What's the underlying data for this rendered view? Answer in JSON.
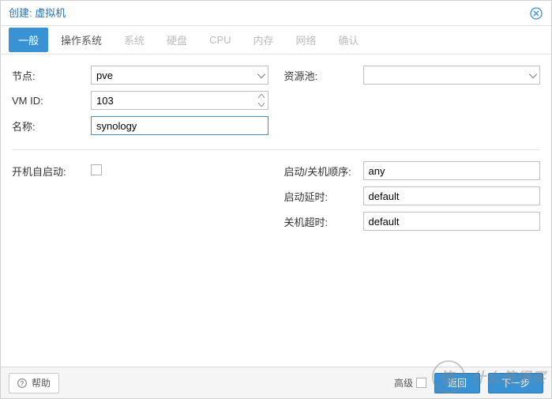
{
  "header": {
    "title": "创建: 虚拟机"
  },
  "tabs": [
    {
      "label": "一般",
      "active": true,
      "disabled": false
    },
    {
      "label": "操作系统",
      "active": false,
      "disabled": false
    },
    {
      "label": "系统",
      "active": false,
      "disabled": true
    },
    {
      "label": "硬盘",
      "active": false,
      "disabled": true
    },
    {
      "label": "CPU",
      "active": false,
      "disabled": true
    },
    {
      "label": "内存",
      "active": false,
      "disabled": true
    },
    {
      "label": "网络",
      "active": false,
      "disabled": true
    },
    {
      "label": "确认",
      "active": false,
      "disabled": true
    }
  ],
  "form": {
    "left": {
      "node_label": "节点:",
      "node_value": "pve",
      "vmid_label": "VM ID:",
      "vmid_value": "103",
      "name_label": "名称:",
      "name_value": "synology",
      "autostart_label": "开机自启动:",
      "autostart_checked": false
    },
    "right": {
      "pool_label": "资源池:",
      "pool_value": "",
      "order_label": "启动/关机顺序:",
      "order_value": "any",
      "startdelay_label": "启动延时:",
      "startdelay_value": "default",
      "shutdown_label": "关机超时:",
      "shutdown_value": "default"
    }
  },
  "footer": {
    "help": "帮助",
    "advanced": "高级",
    "back": "返回",
    "next": "下一步"
  },
  "watermark": {
    "circle": "值",
    "text": "什么值得买"
  }
}
